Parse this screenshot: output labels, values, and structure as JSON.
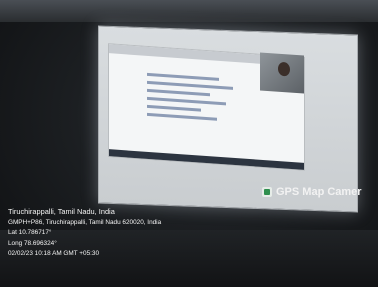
{
  "stamp": {
    "icon": "map-camera-icon",
    "label": "GPS Map Camer"
  },
  "location": {
    "city": "Tiruchirappalli, Tamil Nadu, India",
    "address": "GMPH+P86, Tiruchirappalli, Tamil Nadu 620020, India",
    "lat": "Lat 10.786717°",
    "long": "Long 78.696324°",
    "datetime": "02/02/23 10:18 AM GMT +05:30"
  }
}
